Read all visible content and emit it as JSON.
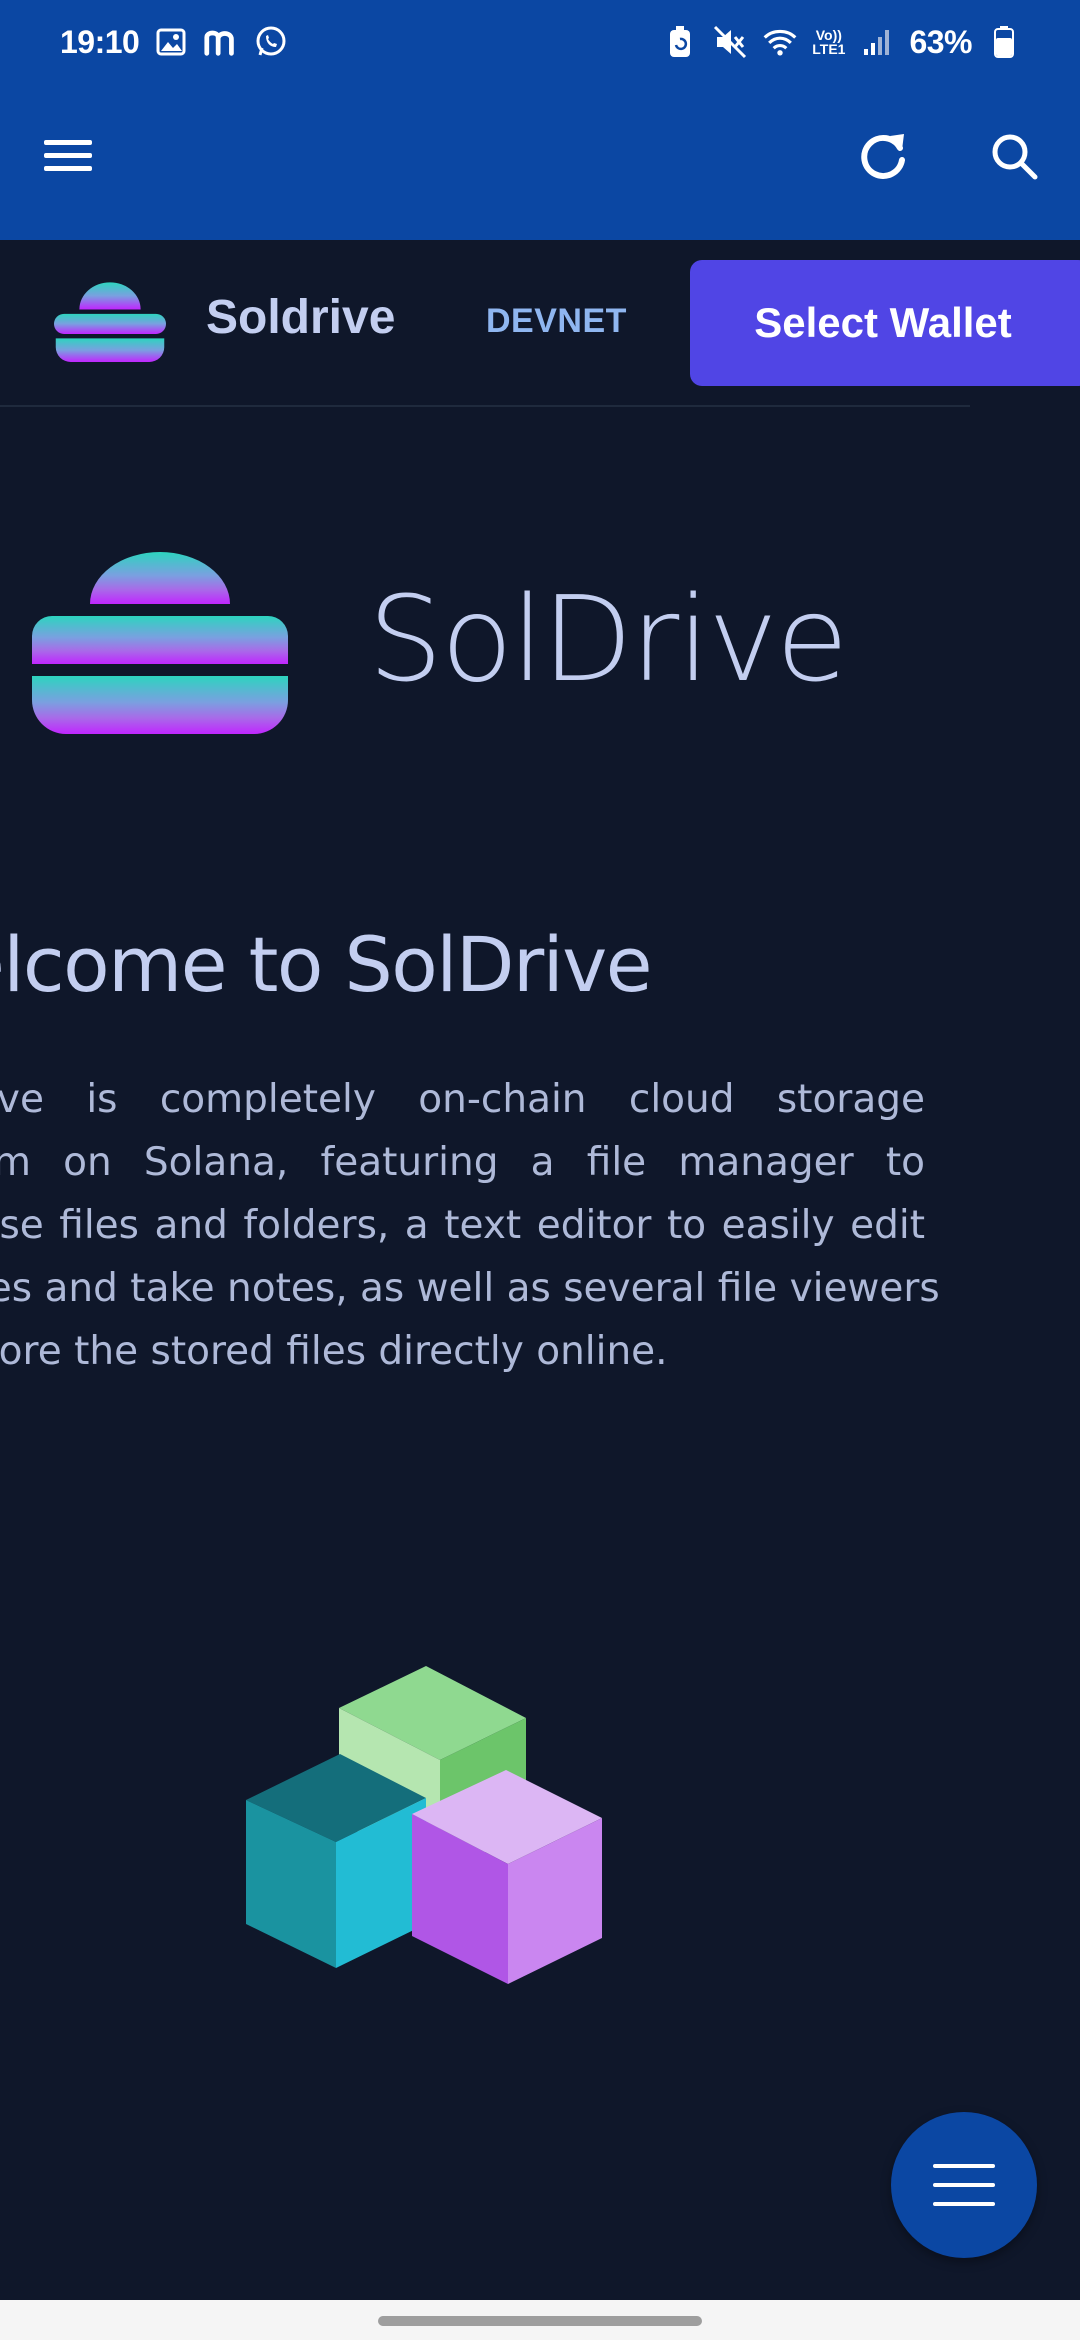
{
  "status_bar": {
    "time": "19:10",
    "battery": "63%",
    "network_line1": "Vo))",
    "network_line2": "LTE1",
    "left_icons": [
      "image-icon",
      "m-app-icon",
      "whatsapp-icon"
    ],
    "right_icons": [
      "battery-saver-icon",
      "mute-icon",
      "wifi-icon",
      "signal-icon",
      "battery-icon"
    ]
  },
  "app_bar": {
    "icons": [
      "menu-icon",
      "refresh-icon",
      "search-icon"
    ]
  },
  "site_header": {
    "brand": "Soldrive",
    "network": "DEVNET",
    "wallet_button": "Select Wallet"
  },
  "hero": {
    "title": "SolDrive"
  },
  "welcome": {
    "heading": "elcome to SolDrive",
    "lines": [
      "Drive is completely on-chain cloud storage",
      "form on Solana, featuring a file manager to",
      "anise files and folders, a text editor to easily edit",
      " files and take notes, as well as several file viewers",
      "xplore the stored files directly online."
    ]
  },
  "fab": {
    "icon": "menu-icon"
  },
  "colors": {
    "app_bar": "#0b47a3",
    "page_bg": "#0f172a",
    "wallet_button": "#5045e5",
    "text": "#c3cef0",
    "network_badge": "#8fb6f0"
  }
}
